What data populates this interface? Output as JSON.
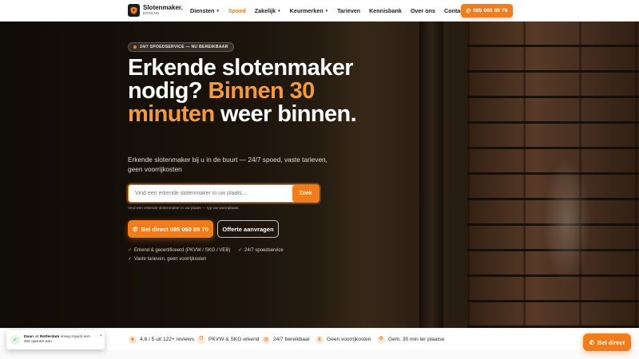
{
  "nav": {
    "logo_name": "Slotenmaker.",
    "logo_sub": "ERKEND",
    "items": [
      {
        "label": "Diensten",
        "dropdown": true
      },
      {
        "label": "Spoed",
        "active": true
      },
      {
        "label": "Zakelijk",
        "dropdown": true
      },
      {
        "label": "Keurmerken",
        "dropdown": true
      },
      {
        "label": "Tarieven"
      },
      {
        "label": "Kennisbank"
      },
      {
        "label": "Over ons"
      },
      {
        "label": "Contact"
      }
    ],
    "phone_cta": "085 060 89 70"
  },
  "hero": {
    "badge": "24/7 SPOEDSERVICE — NU BEREIKBAAR",
    "title_part1": "Erkende slotenmaker nodig?",
    "title_accent": "Binnen 30 minuten",
    "title_part2": "weer binnen.",
    "lead": "Erkende slotenmaker bij u in de buurt — 24/7 spoed, vaste tarieven, geen voorrijkosten",
    "search_placeholder": "Vind een erkende slotenmaker in uw plaats...",
    "search_button": "Zoek",
    "search_hint": "Vind een erkende slotenmaker in uw plaats — typ uw woonplaats.",
    "cta_primary": "Bel direct 085 060 89 70",
    "cta_secondary": "Offerte aanvragen",
    "checks": [
      "Erkend & gecertificeerd (PKVW / SKG / VEB)",
      "24/7 spoedservice",
      "Vaste tarieven, geen voorrijkosten"
    ]
  },
  "trust": [
    {
      "icon": "star-icon",
      "glyph": "★",
      "label": "4,8 / 5 uit 122+ reviews"
    },
    {
      "icon": "shield-icon",
      "glyph": "⛉",
      "label": "PKVW & SKG erkend"
    },
    {
      "icon": "clock-icon",
      "glyph": "◷",
      "label": "24/7 bereikbaar"
    },
    {
      "icon": "euro-icon",
      "glyph": "€",
      "label": "Geen voorrijkosten"
    },
    {
      "icon": "timer-icon",
      "glyph": "⏱",
      "label": "Gem. 30 min ter plaatse"
    }
  ],
  "toast": {
    "prefix": "Daan",
    "mid": " uit ",
    "city": "Rotterdam",
    "suffix": " vroeg zojuist een slot openen aan",
    "close": "×"
  },
  "float_cta": "Bel direct",
  "colors": {
    "accent": "#f07c1b",
    "accent_light": "#f39a3e"
  }
}
